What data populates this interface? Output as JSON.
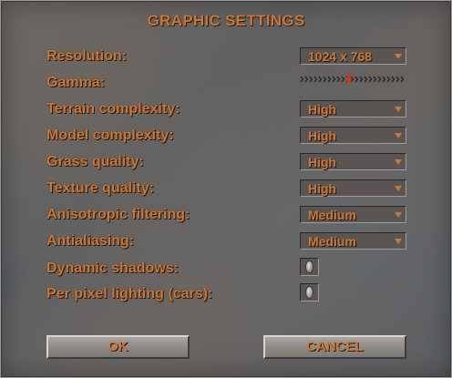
{
  "dialog": {
    "title": "GRAPHIC SETTINGS"
  },
  "settings": {
    "resolution": {
      "label": "Resolution:",
      "value": "1024 x 768"
    },
    "gamma": {
      "label": "Gamma:",
      "level": 0.46
    },
    "terrain": {
      "label": "Terrain complexity:",
      "value": "High"
    },
    "model": {
      "label": "Model complexity:",
      "value": "High"
    },
    "grass": {
      "label": "Grass quality:",
      "value": "High"
    },
    "texture": {
      "label": "Texture quality:",
      "value": "High"
    },
    "anisotropic": {
      "label": "Anisotropic filtering:",
      "value": "Medium"
    },
    "antialiasing": {
      "label": "Antialiasing:",
      "value": "Medium"
    },
    "shadows": {
      "label": "Dynamic shadows:",
      "checked": false
    },
    "lighting": {
      "label": "Per pixel lighting (cars):",
      "checked": false
    }
  },
  "buttons": {
    "ok": "OK",
    "cancel": "CANCEL"
  },
  "colors": {
    "accent": "#c8783a",
    "slider_marker": "#c0392b"
  },
  "icons": {
    "dropdown": "chevron-down-icon",
    "checkbox": "checkbox-icon"
  }
}
